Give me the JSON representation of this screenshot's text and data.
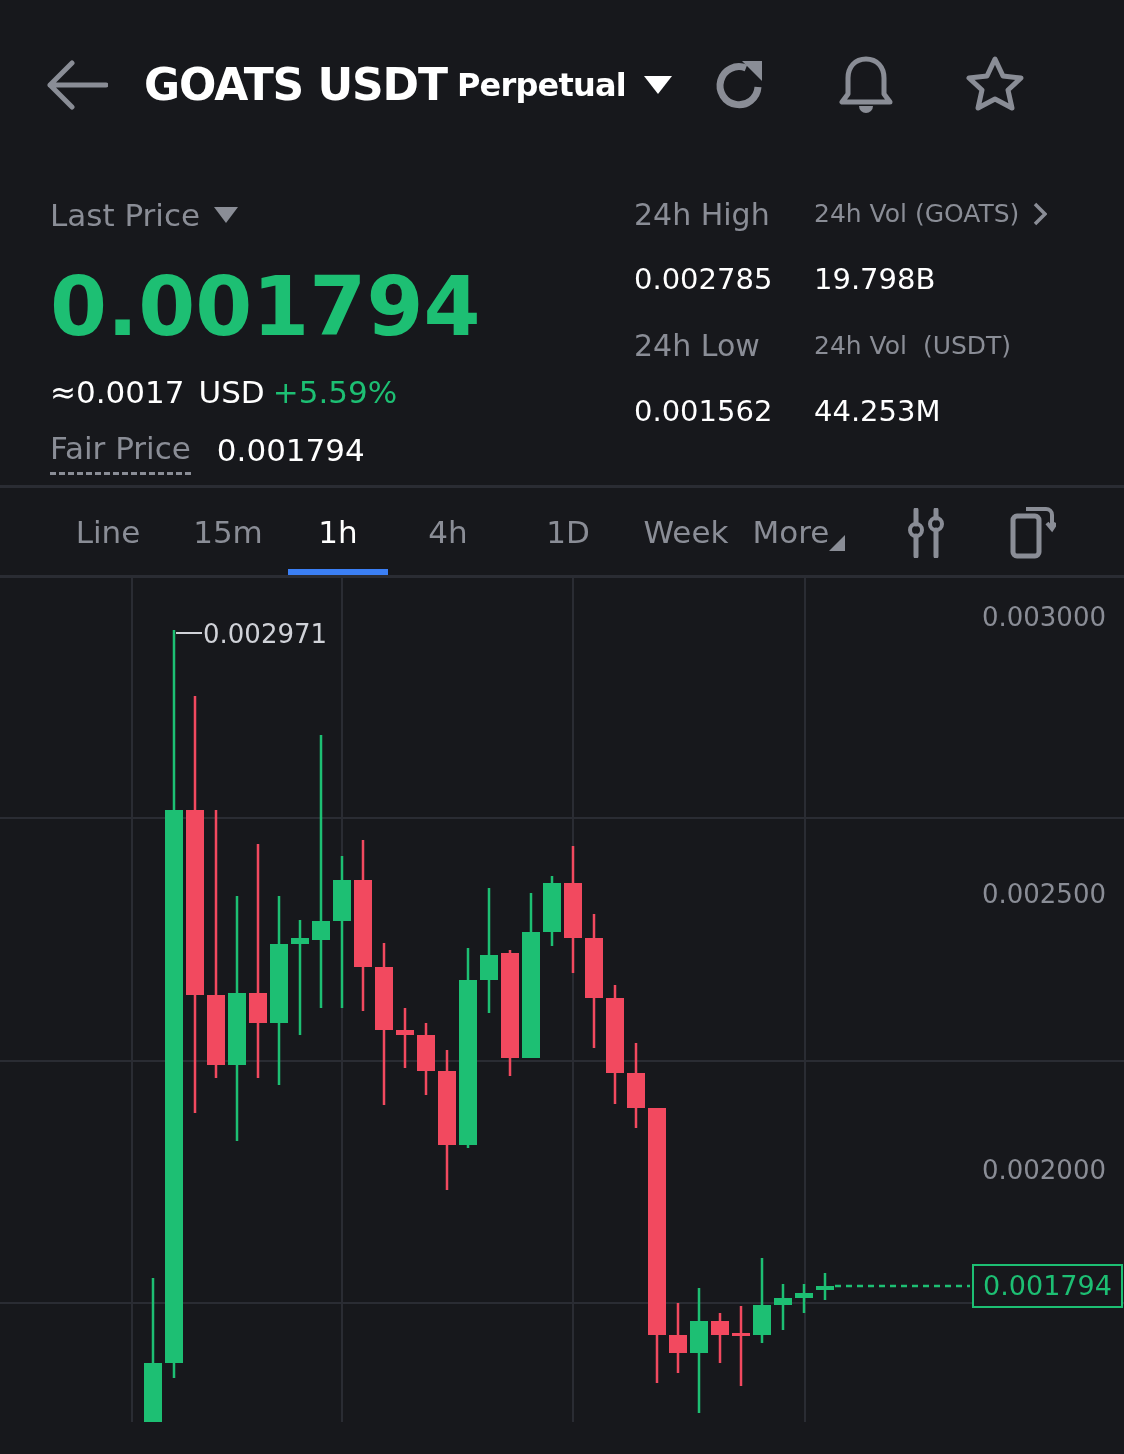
{
  "header": {
    "title": "GOATS USDT",
    "contract_type": "Perpetual"
  },
  "last_price": {
    "label": "Last Price",
    "value": "0.001794",
    "usd": "≈0.0017",
    "usd_unit": "USD",
    "change": "+5.59%",
    "fair_price_label": "Fair Price",
    "fair_price": "0.001794"
  },
  "stats": [
    {
      "label": "24h High",
      "value": "0.002785"
    },
    {
      "label": "24h Vol (GOATS)",
      "value": "19.798B"
    },
    {
      "label": "24h Low",
      "value": "0.001562"
    },
    {
      "label": "24h Vol  (USDT)",
      "value": "44.253M"
    }
  ],
  "tabs": [
    {
      "label": "Line",
      "selected": false
    },
    {
      "label": "15m",
      "selected": false
    },
    {
      "label": "1h",
      "selected": true
    },
    {
      "label": "4h",
      "selected": false
    },
    {
      "label": "1D",
      "selected": false
    },
    {
      "label": "Week",
      "selected": false
    },
    {
      "label": "More",
      "selected": false
    }
  ],
  "chart": {
    "price_ticks": [
      "0.003000",
      "0.002500",
      "0.002000"
    ],
    "high_marker": "0.002971",
    "current_price": "0.001794"
  }
}
